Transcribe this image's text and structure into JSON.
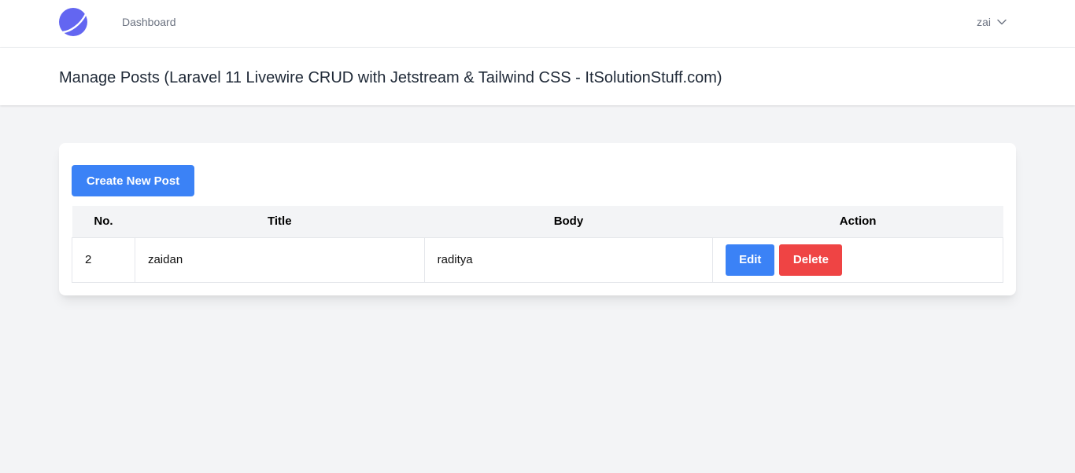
{
  "nav": {
    "dashboard_label": "Dashboard",
    "user_name": "zai"
  },
  "header": {
    "title": "Manage Posts (Laravel 11 Livewire CRUD with Jetstream & Tailwind CSS - ItSolutionStuff.com)"
  },
  "main": {
    "create_button_label": "Create New Post",
    "table": {
      "columns": [
        "No.",
        "Title",
        "Body",
        "Action"
      ],
      "rows": [
        {
          "no": "2",
          "title": "zaidan",
          "body": "raditya",
          "edit_label": "Edit",
          "delete_label": "Delete"
        }
      ]
    }
  },
  "colors": {
    "accent": "#3b82f6",
    "danger": "#ef4444",
    "logo": "#6366f1",
    "background": "#f3f4f6"
  }
}
